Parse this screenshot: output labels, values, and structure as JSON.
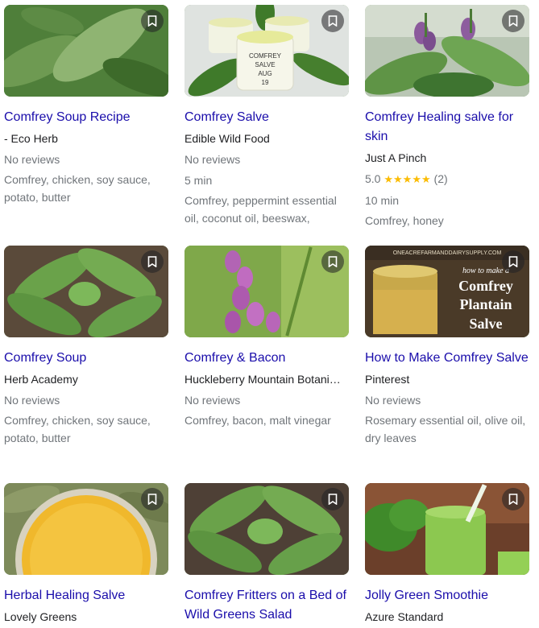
{
  "cards": [
    {
      "title": "Comfrey Soup Recipe",
      "source": "- Eco Herb",
      "reviews": "No reviews",
      "ingredients": "Comfrey, chicken, soy sauce, potato, butter"
    },
    {
      "title": "Comfrey Salve",
      "source": "Edible Wild Food",
      "reviews": "No reviews",
      "time": "5 min",
      "ingredients": "Comfrey, peppermint essential oil, coconut oil, beeswax,"
    },
    {
      "title": "Comfrey Healing salve for skin",
      "source": "Just A Pinch",
      "rating": "5.0",
      "stars": "★★★★★",
      "count": "(2)",
      "time": "10 min",
      "ingredients": "Comfrey, honey"
    },
    {
      "title": "Comfrey Soup",
      "source": "Herb Academy",
      "reviews": "No reviews",
      "ingredients": "Comfrey, chicken, soy sauce, potato, butter"
    },
    {
      "title": "Comfrey & Bacon",
      "source": "Huckleberry Mountain Botani…",
      "reviews": "No reviews",
      "ingredients": "Comfrey, bacon, malt vinegar"
    },
    {
      "title": "How to Make Comfrey Salve",
      "source": "Pinterest",
      "reviews": "No reviews",
      "ingredients": "Rosemary essential oil, olive oil, dry leaves",
      "image_text": [
        "how to make a",
        "Comfrey",
        "Plantain",
        "Salve"
      ],
      "watermark": "ONEACREFARMANDDAIRYSUPPLY.COM"
    },
    {
      "title": "Herbal Healing Salve",
      "source": "Lovely Greens"
    },
    {
      "title": "Comfrey Fritters on a Bed of Wild Greens Salad",
      "source": ""
    },
    {
      "title": "Jolly Green Smoothie",
      "source": "Azure Standard"
    }
  ],
  "jar_label": [
    "COMFREY",
    "SALVE",
    "AUG",
    "19"
  ],
  "colors": {
    "link": "#1a0dab",
    "text": "#202124",
    "muted": "#70757a",
    "star": "#fbbc04"
  },
  "icons": {
    "bookmark": "bookmark-icon"
  }
}
